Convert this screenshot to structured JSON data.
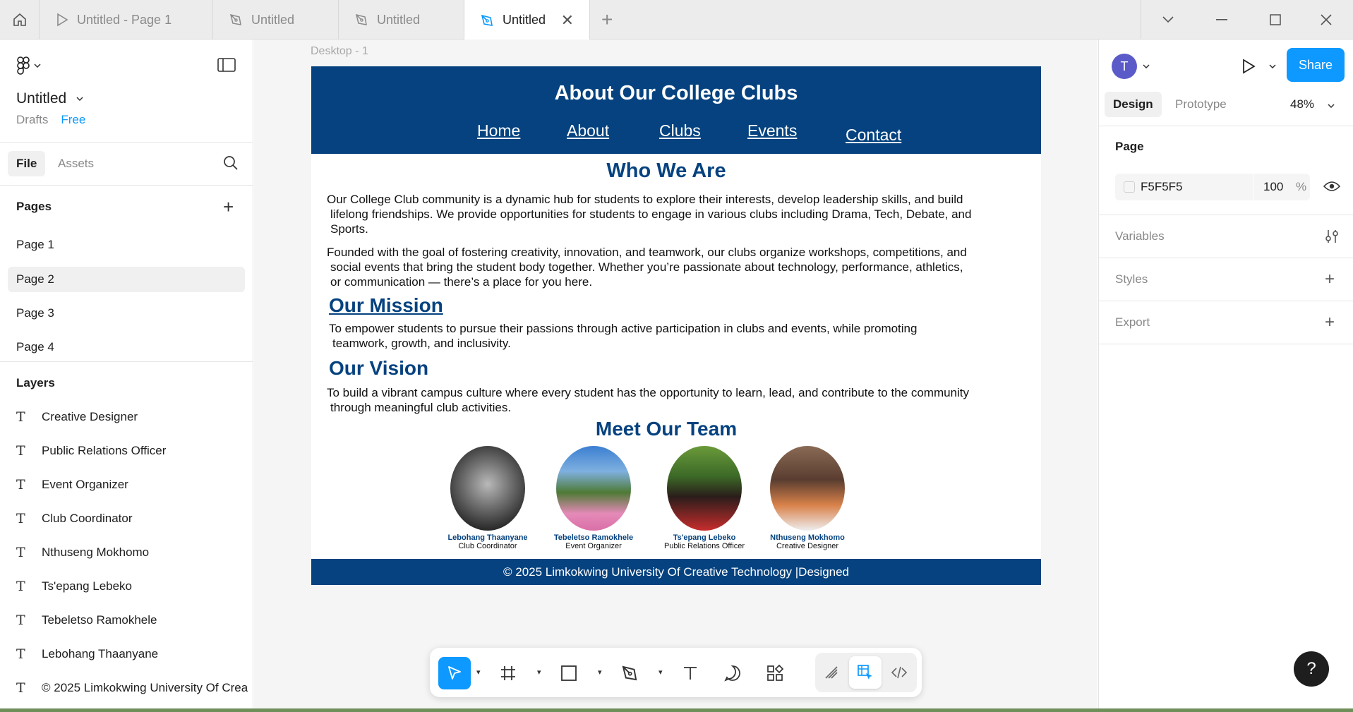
{
  "tabs": [
    {
      "label": "Untitled - Page 1",
      "icon": "play-icon"
    },
    {
      "label": "Untitled",
      "icon": "pen-icon"
    },
    {
      "label": "Untitled",
      "icon": "pen-icon"
    },
    {
      "label": "Untitled",
      "icon": "pen-icon",
      "active": true
    }
  ],
  "file": {
    "title": "Untitled",
    "location": "Drafts",
    "plan": "Free"
  },
  "left_tabs": {
    "file": "File",
    "assets": "Assets"
  },
  "pages": {
    "title": "Pages",
    "items": [
      "Page 1",
      "Page 2",
      "Page 3",
      "Page 4"
    ],
    "selected": "Page 2"
  },
  "layers": {
    "title": "Layers",
    "items": [
      "Creative Designer",
      "Public Relations Officer",
      "Event Organizer",
      "Club Coordinator",
      "Nthuseng Mokhomo",
      "Ts'epang Lebeko",
      "Tebeletso Ramokhele",
      "Lebohang Thaanyane",
      "© 2025 Limkokwing University Of Crea"
    ]
  },
  "canvas": {
    "frame_label": "Desktop - 1",
    "site": {
      "title": "About Our College Clubs",
      "nav": [
        "Home",
        "About",
        "Clubs",
        "Events",
        "Contact"
      ],
      "who_title": "Who We Are",
      "who_p1_l1": "Our College Club community is a dynamic hub for students to explore their interests, develop leadership skills, and build",
      "who_p1_l2": "lifelong friendships. We provide opportunities for students to engage in various clubs including Drama, Tech, Debate, and",
      "who_p1_l3": "Sports.",
      "who_p2_l1": "Founded with the goal of fostering creativity, innovation, and teamwork, our clubs organize workshops, competitions, and",
      "who_p2_l2": "social events that bring the student body together. Whether you’re passionate about technology, performance, athletics,",
      "who_p2_l3": "or communication — there’s a place for you here.",
      "mission_title": "Our Mission",
      "mission_l1": "To empower students to pursue their passions through active participation in clubs and events, while promoting",
      "mission_l2": "teamwork, growth, and inclusivity.",
      "vision_title": "Our Vision",
      "vision_l1": "To build a vibrant campus culture where every student has the opportunity to learn, lead, and contribute to the community",
      "vision_l2": "through meaningful club activities.",
      "team_title": "Meet Our Team",
      "team": [
        {
          "name": "Lebohang Thaanyane",
          "role": "Club Coordinator"
        },
        {
          "name": "Tebeletso Ramokhele",
          "role": "Event Organizer"
        },
        {
          "name": "Ts'epang Lebeko",
          "role": "Public Relations Officer"
        },
        {
          "name": "Nthuseng Mokhomo",
          "role": "Creative Designer"
        }
      ],
      "footer": "© 2025 Limkokwing University Of Creative Technology |Designed",
      "brand_color": "#05427f"
    }
  },
  "right_panel": {
    "avatar_letter": "T",
    "share": "Share",
    "tabs": {
      "design": "Design",
      "prototype": "Prototype"
    },
    "zoom": "48%",
    "page_section": "Page",
    "page_fill": "F5F5F5",
    "page_opacity": "100",
    "percent": "%",
    "variables": "Variables",
    "styles": "Styles",
    "export": "Export"
  },
  "help": "?"
}
